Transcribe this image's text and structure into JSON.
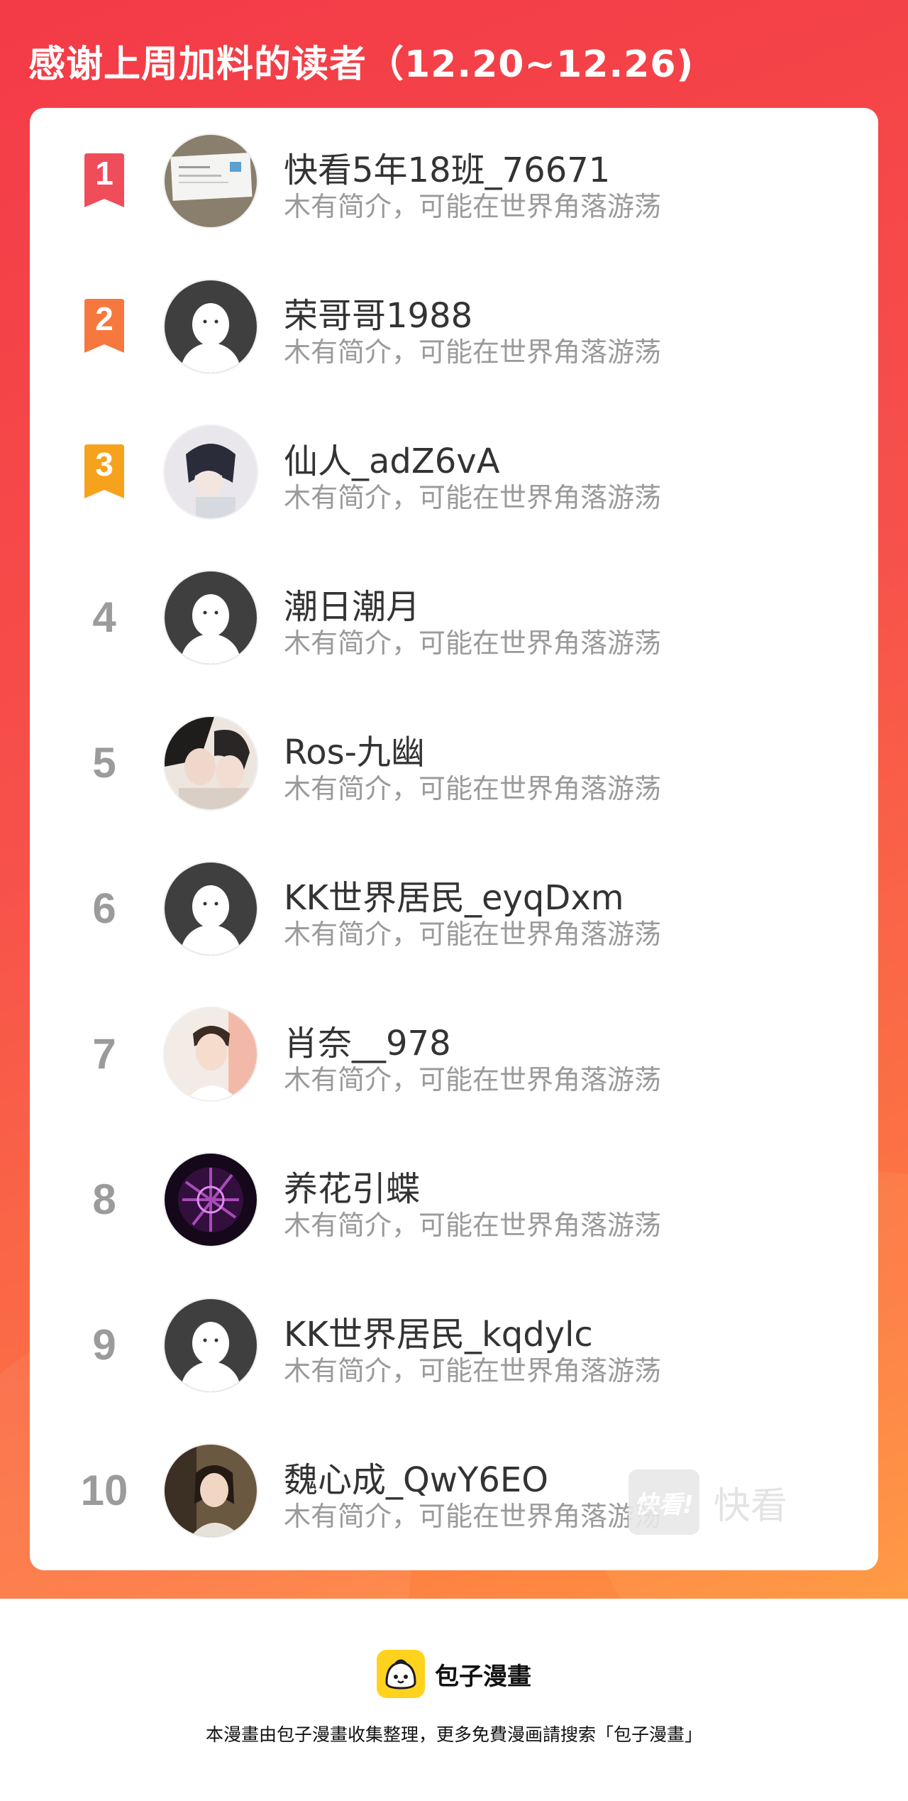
{
  "header": {
    "title": "感谢上周加料的读者（12.20~12.26)"
  },
  "colors": {
    "gradient_start": "#f33a47",
    "gradient_end": "#ff9440",
    "rank1": "#f04d5a",
    "rank2": "#f6783e",
    "rank3": "#f7a21d",
    "rank_other": "#9b9b9b"
  },
  "readers": [
    {
      "rank": "1",
      "name": "快看5年18班_76671",
      "bio": "木有简介，可能在世界角落游荡",
      "avatar": "business-card-photo"
    },
    {
      "rank": "2",
      "name": "荣哥哥1988",
      "bio": "木有简介，可能在世界角落游荡",
      "avatar": "default-avatar"
    },
    {
      "rank": "3",
      "name": "仙人_adZ6vA",
      "bio": "木有简介，可能在世界角落游荡",
      "avatar": "anime-boy-avatar"
    },
    {
      "rank": "4",
      "name": "潮日潮月",
      "bio": "木有简介，可能在世界角落游荡",
      "avatar": "default-avatar"
    },
    {
      "rank": "5",
      "name": "Ros-九幽",
      "bio": "木有简介，可能在世界角落游荡",
      "avatar": "manhwa-couple-avatar"
    },
    {
      "rank": "6",
      "name": "KK世界居民_eyqDxm",
      "bio": "木有简介，可能在世界角落游荡",
      "avatar": "default-avatar"
    },
    {
      "rank": "7",
      "name": "肖奈__978",
      "bio": "木有简介，可能在世界角落游荡",
      "avatar": "young-man-photo"
    },
    {
      "rank": "8",
      "name": "养花引蝶",
      "bio": "木有简介，可能在世界角落游荡",
      "avatar": "purple-calligraphy-avatar"
    },
    {
      "rank": "9",
      "name": "KK世界居民_kqdylc",
      "bio": "木有简介，可能在世界角落游荡",
      "avatar": "default-avatar"
    },
    {
      "rank": "10",
      "name": "魏心成_QwY6EO",
      "bio": "木有简介，可能在世界角落游荡",
      "avatar": "woman-photo-avatar"
    }
  ],
  "watermark": {
    "logo_text": "快看!",
    "text": "快看"
  },
  "footer": {
    "brand_name": "包子漫畫",
    "note": "本漫畫由包子漫畫收集整理，更多免費漫画請搜索「包子漫畫」"
  }
}
